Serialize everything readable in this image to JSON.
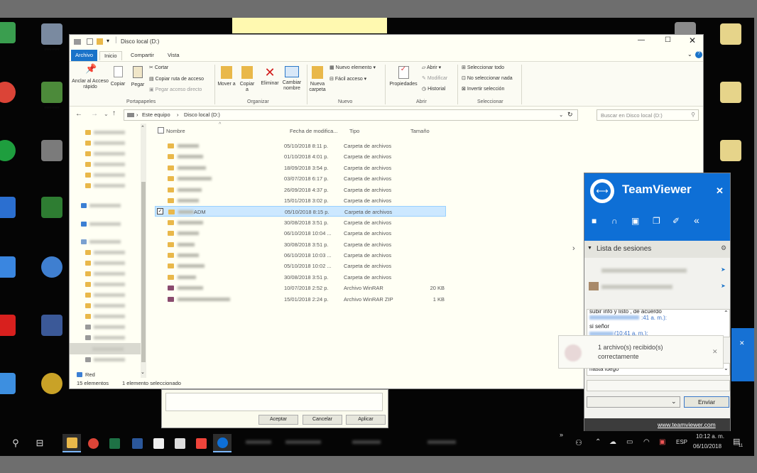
{
  "explorer": {
    "title": "Disco local (D:)",
    "ribbon_tabs": [
      "Archivo",
      "Inicio",
      "Compartir",
      "Vista"
    ],
    "ribbon": {
      "pin_label": "Anclar al Acceso rápido",
      "copy_label": "Copiar",
      "paste_label": "Pegar",
      "cut_label": "Cortar",
      "copy_path_label": "Copiar ruta de acceso",
      "paste_shortcut_label": "Pegar acceso directo",
      "move_to_label": "Mover a",
      "copy_to_label": "Copiar a",
      "delete_label": "Eliminar",
      "rename_label": "Cambiar nombre",
      "new_folder_label": "Nueva carpeta",
      "new_item_label": "Nuevo elemento",
      "easy_access_label": "Fácil acceso",
      "properties_label": "Propiedades",
      "open_label": "Abrir",
      "edit_label": "Modificar",
      "history_label": "Historial",
      "select_all_label": "Seleccionar todo",
      "select_none_label": "No seleccionar nada",
      "invert_selection_label": "Invertir selección",
      "groups": [
        "Portapapeles",
        "Organizar",
        "Nuevo",
        "Abrir",
        "Seleccionar"
      ]
    },
    "address": {
      "crumb1": "Este equipo",
      "crumb2": "Disco local (D:)"
    },
    "search_placeholder": "Buscar en Disco local (D:)",
    "columns": {
      "name": "Nombre",
      "date": "Fecha de modifica...",
      "type": "Tipo",
      "size": "Tamaño"
    },
    "files": [
      {
        "name": "",
        "date": "05/10/2018 8:11 p.",
        "type": "Carpeta de archivos",
        "size": ""
      },
      {
        "name": "",
        "date": "01/10/2018 4:01 p.",
        "type": "Carpeta de archivos",
        "size": ""
      },
      {
        "name": "",
        "date": "18/09/2018 3:54 p.",
        "type": "Carpeta de archivos",
        "size": ""
      },
      {
        "name": "",
        "date": "03/07/2018 6:17 p.",
        "type": "Carpeta de archivos",
        "size": ""
      },
      {
        "name": "",
        "date": "26/09/2018 4:37 p.",
        "type": "Carpeta de archivos",
        "size": ""
      },
      {
        "name": "",
        "date": "15/01/2018 3:02 p.",
        "type": "Carpeta de archivos",
        "size": ""
      },
      {
        "name": "ADM",
        "date": "05/10/2018 8:15 p.",
        "type": "Carpeta de archivos",
        "size": "",
        "selected": true
      },
      {
        "name": "",
        "date": "30/08/2018 3:51 p.",
        "type": "Carpeta de archivos",
        "size": ""
      },
      {
        "name": "",
        "date": "06/10/2018 10:04 ...",
        "type": "Carpeta de archivos",
        "size": ""
      },
      {
        "name": "",
        "date": "30/08/2018 3:51 p.",
        "type": "Carpeta de archivos",
        "size": ""
      },
      {
        "name": "",
        "date": "06/10/2018 10:03 ...",
        "type": "Carpeta de archivos",
        "size": ""
      },
      {
        "name": "",
        "date": "05/10/2018 10:02 ...",
        "type": "Carpeta de archivos",
        "size": ""
      },
      {
        "name": "",
        "date": "30/08/2018 3:51 p.",
        "type": "Carpeta de archivos",
        "size": ""
      },
      {
        "name": "",
        "date": "10/07/2018 2:52 p.",
        "type": "Archivo WinRAR",
        "size": "20 KB"
      },
      {
        "name": "",
        "date": "15/01/2018 2:24 p.",
        "type": "Archivo WinRAR ZIP",
        "size": "1 KB"
      }
    ],
    "status_count": "15 elementos",
    "status_selected": "1 elemento seleccionado",
    "nav_network": "Red"
  },
  "dialog": {
    "ok": "Aceptar",
    "cancel": "Cancelar",
    "apply": "Aplicar"
  },
  "teamviewer": {
    "brand": "TeamViewer",
    "sessions_label": "Lista de sesiones",
    "chat_line1": "subir info y listo , de acuerdo",
    "chat_time1": ":41 a. m.):",
    "chat_line2": "si señor",
    "chat_line3": "(10:41 a. m.):",
    "draft": "hasta luego",
    "send": "Enviar",
    "footer_link": "www.teamviewer.com"
  },
  "notification": {
    "line1": "1 archivo(s) recibido(s)",
    "line2": "correctamente"
  },
  "taskbar": {
    "lang": "ESP",
    "time": "10:12 a. m.",
    "date": "06/10/2018",
    "notif_count": "11"
  },
  "colors": {
    "accent": "#1a73c9",
    "teamviewer": "#0e6fd6",
    "selection": "#cce8ff"
  }
}
